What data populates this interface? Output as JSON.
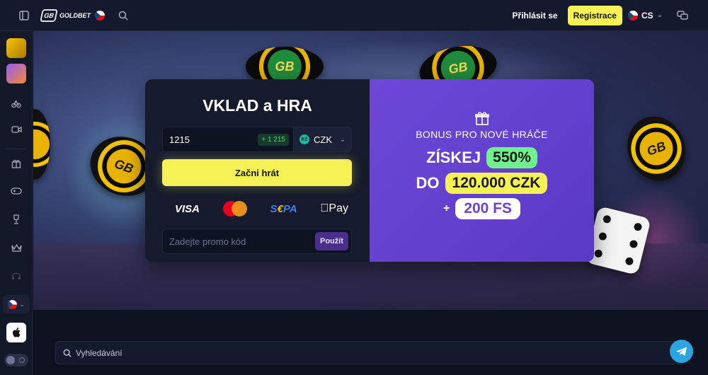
{
  "header": {
    "brand": "GOLDBET",
    "login_label": "Přihlásit se",
    "register_label": "Registrace",
    "language": "CS"
  },
  "deposit": {
    "title": "VKLAD a HRA",
    "amount": "1215",
    "bonus_amount": "+ 1 215",
    "currency": "CZK",
    "currency_badge": "Kč",
    "play_label": "Začni hrát",
    "payment_methods": [
      "VISA",
      "Mastercard",
      "SEPA",
      "Apple Pay"
    ],
    "promo_placeholder": "Zadejte promo kód",
    "promo_button": "Použít"
  },
  "bonus": {
    "heading": "BONUS PRO NOVÉ HRÁČE",
    "line1_word": "ZÍSKEJ",
    "line1_value": "550%",
    "line2_word": "DO",
    "line2_value": "120.000 CZK",
    "line3_prefix": "+",
    "line3_value": "200 FS"
  },
  "search": {
    "placeholder": "Vyhledávání"
  },
  "colors": {
    "accent_yellow": "#f6f256",
    "purple": "#6d48d8",
    "green": "#6ff28a",
    "background": "#0d1120"
  },
  "icons": [
    "sidebar-toggle-icon",
    "search-icon",
    "chat-icon",
    "gift-icon",
    "video-icon",
    "gamepad-icon",
    "trophy-icon",
    "crown-icon",
    "headset-icon",
    "apple-icon",
    "telegram-icon"
  ]
}
